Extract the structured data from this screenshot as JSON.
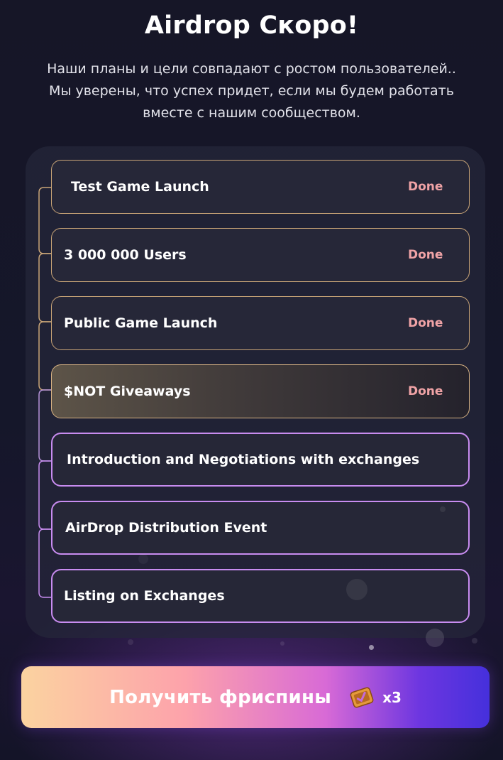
{
  "header": {
    "title": "Airdrop Скоро!",
    "subtitle_line1": "Наши планы и цели совпадают с ростом пользователей..",
    "subtitle_line2": "Мы уверены, что успех придет, если мы будем работать",
    "subtitle_line3": "вместе с нашим сообществом."
  },
  "roadmap": {
    "items": [
      {
        "label": "Test Game Launch",
        "status": "Done"
      },
      {
        "label": "3 000 000 Users",
        "status": "Done"
      },
      {
        "label": "Public Game Launch",
        "status": "Done"
      },
      {
        "label": "$NOT Giveaways",
        "status": "Done"
      },
      {
        "label": "Introduction and Negotiations with exchanges",
        "status": ""
      },
      {
        "label": "AirDrop Distribution Event",
        "status": ""
      },
      {
        "label": "Listing on Exchanges",
        "status": ""
      }
    ]
  },
  "cta": {
    "label": "Получить фриспины",
    "icon": "ticket-icon",
    "multiplier": "x3"
  },
  "colors": {
    "done_status": "#f0a3a6",
    "done_border": "#c9a577",
    "pending_border": "#c88cf0",
    "background": "#161627"
  }
}
